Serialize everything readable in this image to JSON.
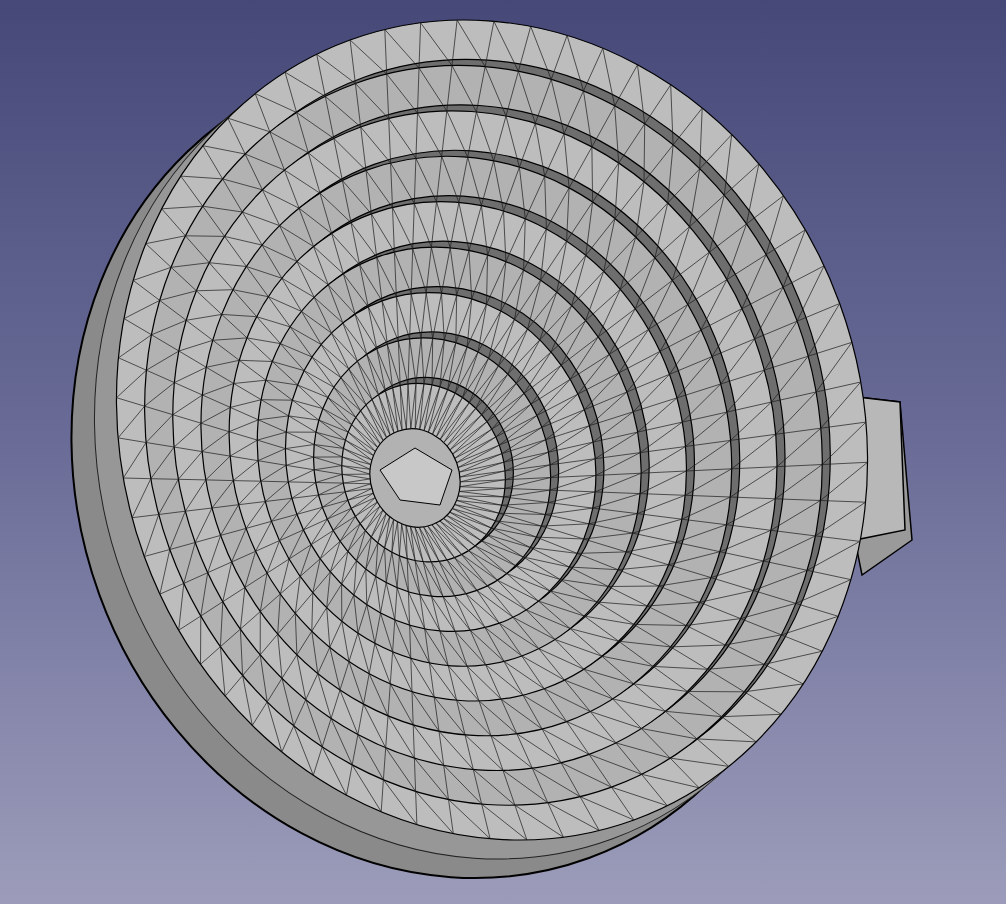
{
  "viewport": {
    "model": {
      "kind": "triangle-mesh"
    }
  }
}
